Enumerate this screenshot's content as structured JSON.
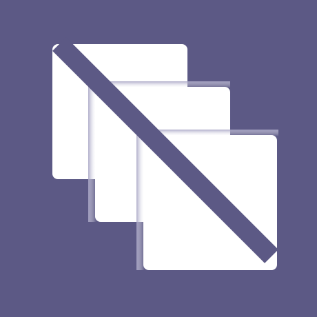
{
  "icon": {
    "name": "no-stack-icon",
    "background_color": "#5c5985",
    "card_color": "#ffffff",
    "shadow_color": "#c7c6d7"
  }
}
